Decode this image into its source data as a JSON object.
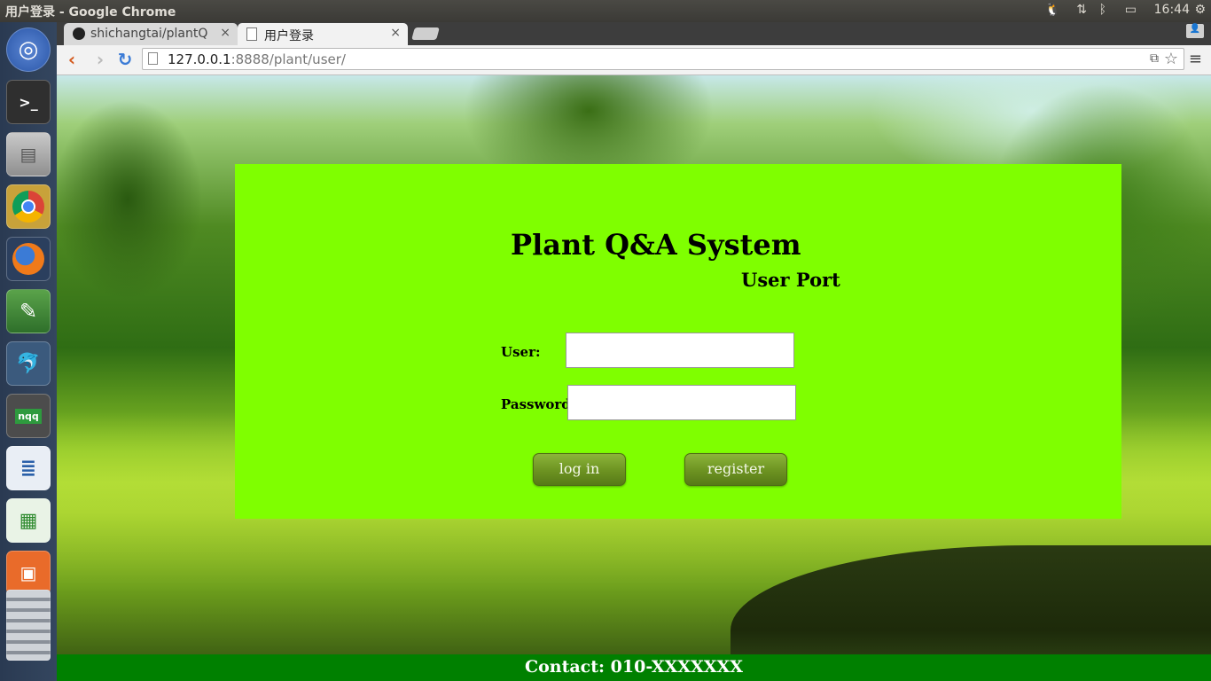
{
  "os_panel": {
    "window_title": "用户登录 - Google Chrome",
    "clock": "16:44"
  },
  "launcher": {
    "apps": [
      {
        "name": "ubuntu-dash"
      },
      {
        "name": "terminal"
      },
      {
        "name": "files"
      },
      {
        "name": "chrome"
      },
      {
        "name": "firefox"
      },
      {
        "name": "text-editor"
      },
      {
        "name": "mysql-workbench"
      },
      {
        "name": "nqq",
        "label": "nqq"
      },
      {
        "name": "libreoffice-writer"
      },
      {
        "name": "libreoffice-calc"
      },
      {
        "name": "libreoffice-impress"
      }
    ]
  },
  "browser": {
    "tabs": [
      {
        "label": "shichangtai/plantQ",
        "icon": "github-icon"
      },
      {
        "label": "用户登录",
        "icon": "page-icon"
      }
    ],
    "url_host": "127.0.0.1",
    "url_rest": ":8888/plant/user/"
  },
  "page": {
    "title": "Plant Q&A System",
    "subtitle": "User Port",
    "user_label": "User:",
    "password_label": "Password:",
    "user_value": "",
    "password_value": "",
    "login_button": "log in",
    "register_button": "register",
    "footer_contact": "Contact: 010-XXXXXXX",
    "colors": {
      "panel": "#7fff00",
      "footer": "#008000"
    }
  }
}
